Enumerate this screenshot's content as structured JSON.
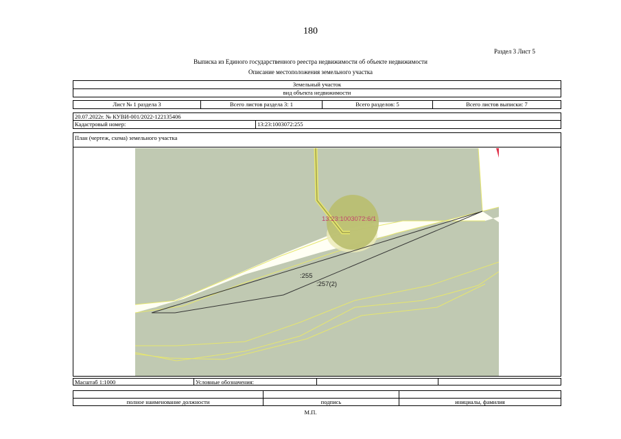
{
  "page_number": "180",
  "section_ref": "Раздел 3   Лист 5",
  "title": "Выписка из Единого государственного реестра недвижимости об объекте недвижимости",
  "subtitle": "Описание местоположения земельного участка",
  "object_type": "Земельный участок",
  "object_type_caption": "вид объекта недвижимости",
  "sheet_info": {
    "sheet": "Лист № 1 раздела 3",
    "total_sheets_section": "Всего листов раздела 3: 1",
    "total_sections": "Всего разделов: 5",
    "total_sheets_extract": "Всего листов выписки: 7"
  },
  "doc_date_number": "20.07.2022г. № КУВИ-001/2022-122135406",
  "cadastral_label": "Кадастровый номер:",
  "cadastral_number": "13:23:1003072:255",
  "map": {
    "caption": "План (чертеж, схема) земельного участка",
    "labels": {
      "neighbor": "13:23:1003072:6/1",
      "parcel": ":255",
      "adjacent": ":257(2)"
    },
    "colors": {
      "land": "#c0c9b2",
      "road_fill": "#fffff4",
      "boundary_yellow": "#e6e66e",
      "parcel_line": "#333333",
      "circle": "#b9be6e",
      "circle_lower": "#ecebb8",
      "neighbor_label": "#c0446a",
      "marker": "#e0344c"
    }
  },
  "scale": "Масштаб 1:1000",
  "legend_label": "Условные обозначения:",
  "signature": {
    "position": "полное наименование должности",
    "signature": "подпись",
    "name": "инициалы, фамилия"
  },
  "stamp": "М.П."
}
